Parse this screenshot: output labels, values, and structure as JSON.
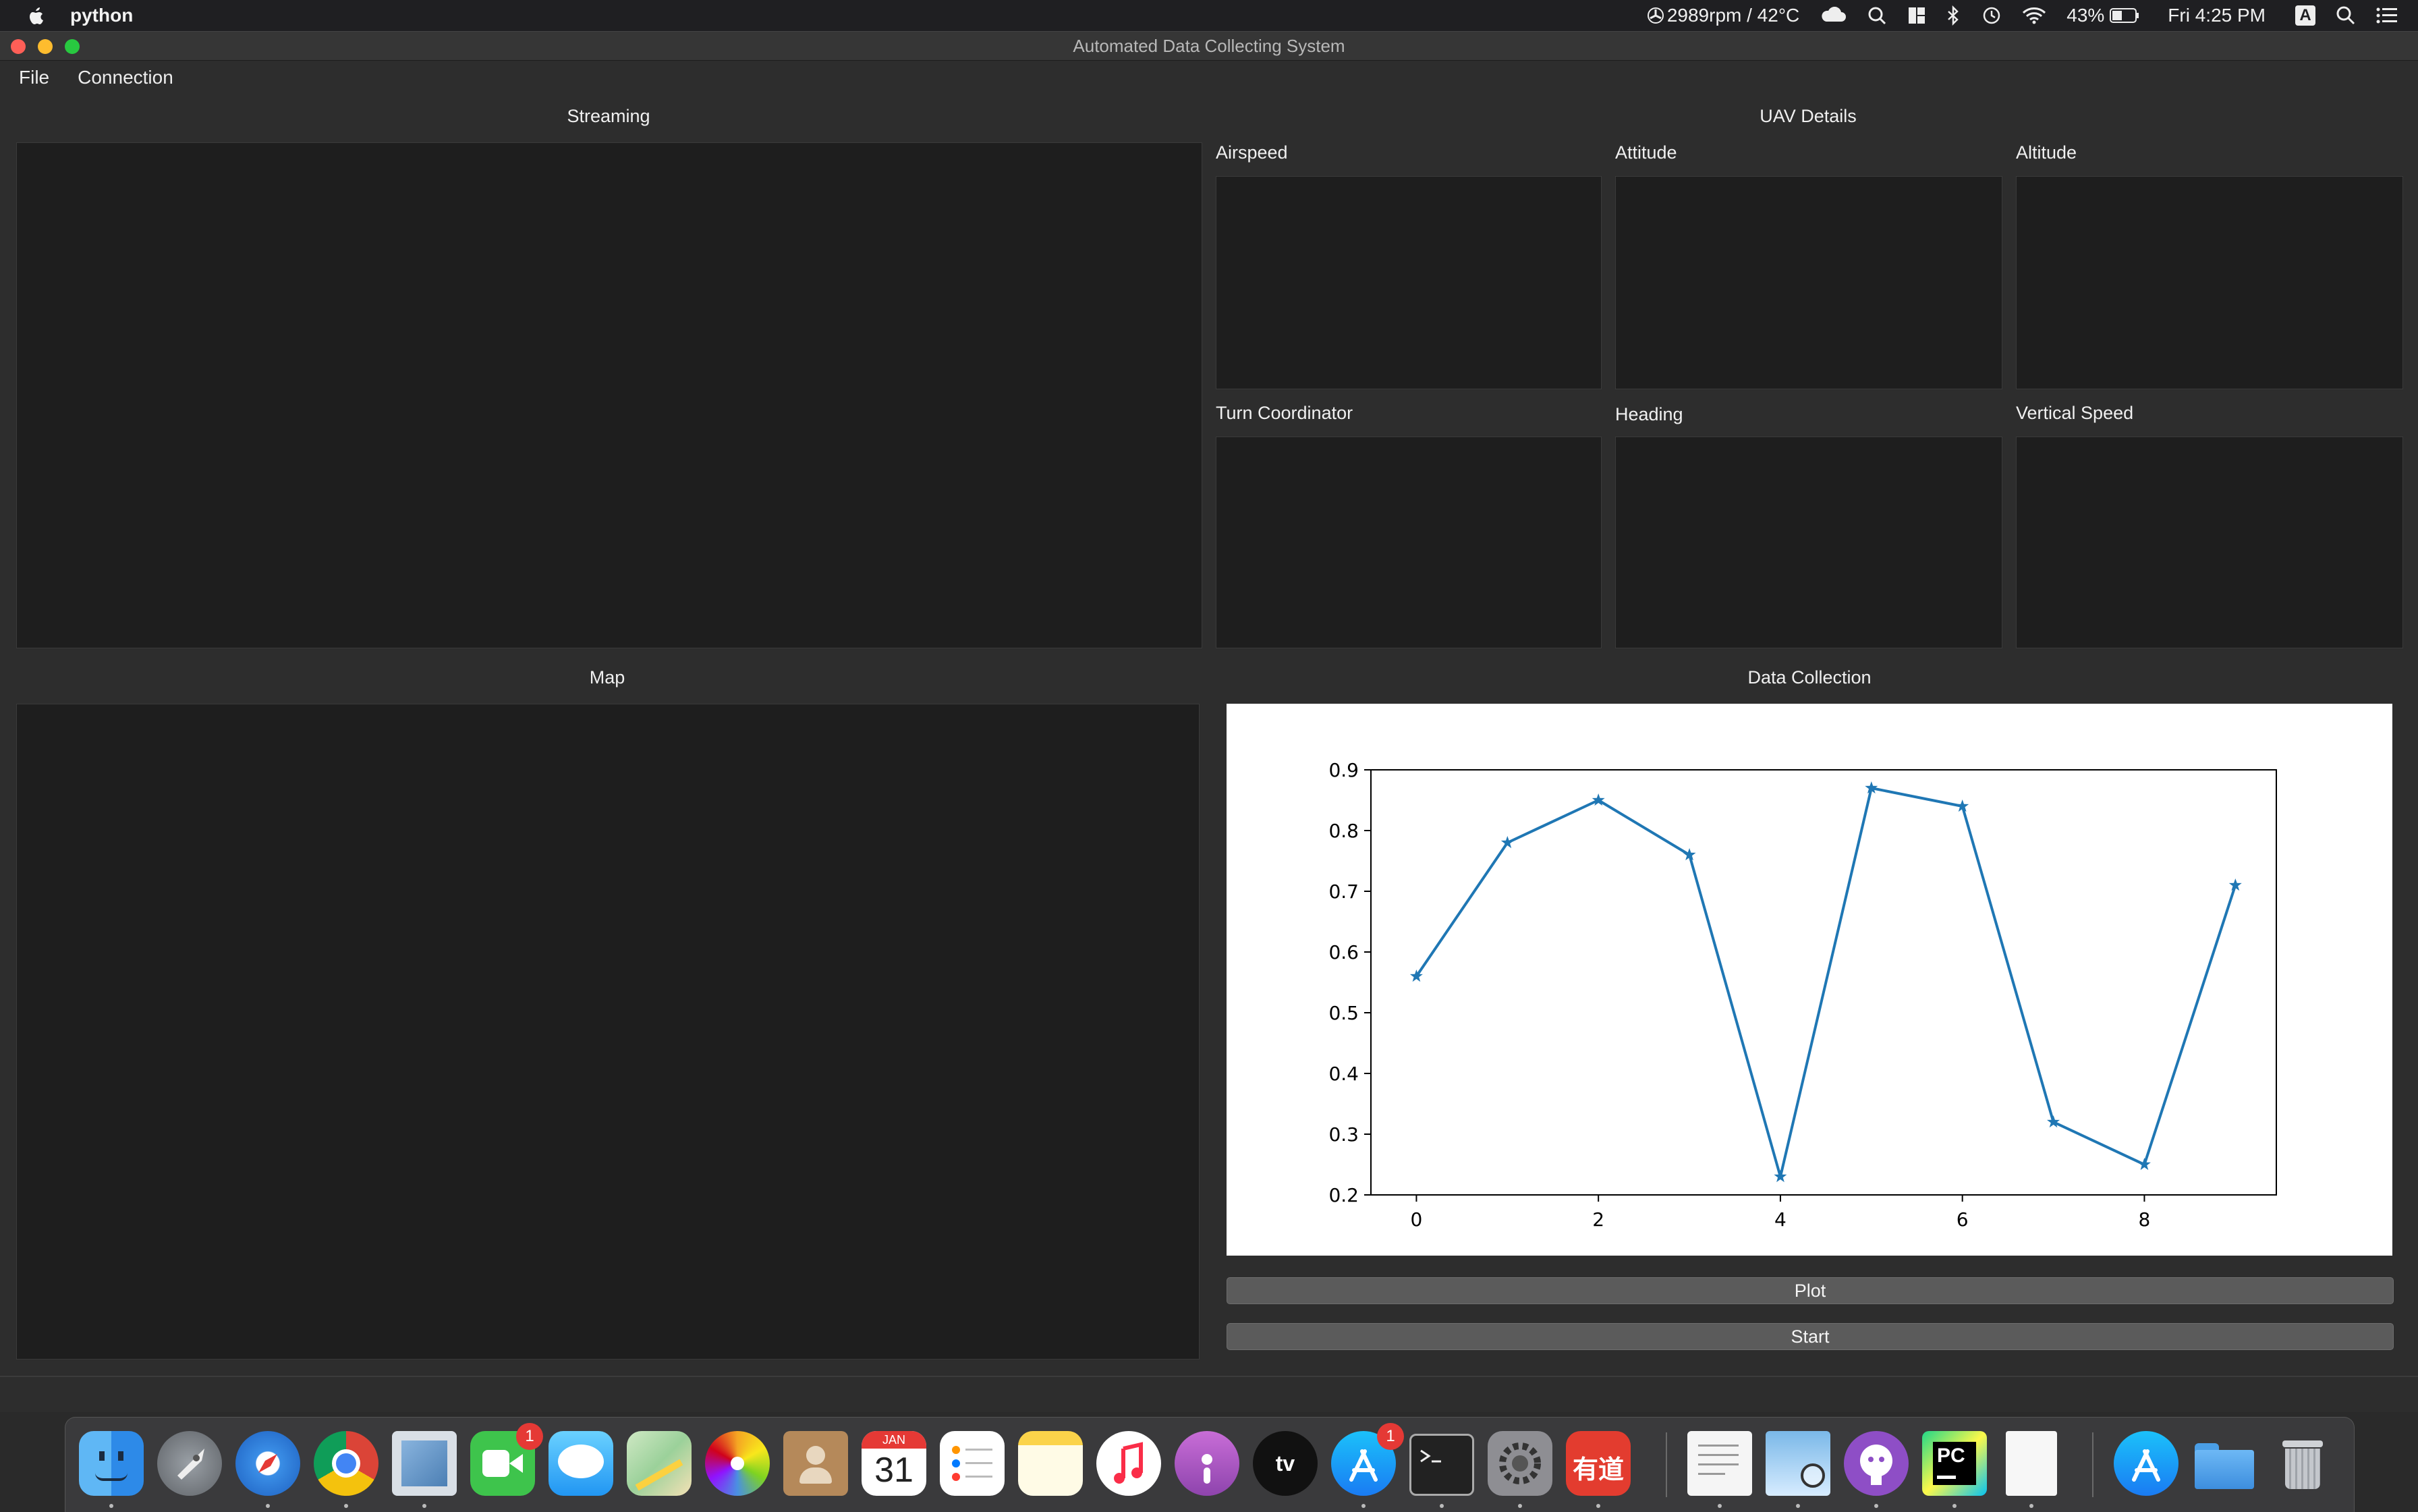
{
  "menubar": {
    "app_name": "python",
    "status": {
      "fan_temp": "2989rpm / 42°C",
      "battery": "43%",
      "clock": "Fri 4:25 PM",
      "input_source": "A"
    }
  },
  "window": {
    "title": "Automated Data Collecting System",
    "menu": [
      "File",
      "Connection"
    ]
  },
  "sections": {
    "streaming": "Streaming",
    "uav_details": "UAV Details",
    "map": "Map",
    "data_collection": "Data Collection"
  },
  "instruments": [
    "Airspeed",
    "Attitude",
    "Altitude",
    "Turn Coordinator",
    "Heading",
    "Vertical Speed"
  ],
  "buttons": {
    "plot": "Plot",
    "start": "Start"
  },
  "colors": {
    "series": "#1f77b4",
    "panel_bg": "#1e1e1e",
    "window_bg": "#2d2d2d"
  },
  "chart_data": {
    "type": "line",
    "marker": "star",
    "x": [
      0,
      1,
      2,
      3,
      4,
      5,
      6,
      7,
      8,
      9
    ],
    "series": [
      {
        "values": [
          0.56,
          0.78,
          0.85,
          0.76,
          0.23,
          0.87,
          0.84,
          0.32,
          0.25,
          0.71
        ]
      }
    ],
    "xticks": [
      0,
      2,
      4,
      6,
      8
    ],
    "yticks": [
      0.2,
      0.3,
      0.4,
      0.5,
      0.6,
      0.7,
      0.8,
      0.9
    ],
    "xlim": [
      -0.5,
      9.45
    ],
    "ylim": [
      0.2,
      0.9
    ],
    "grid": false,
    "legend": false
  },
  "dock": {
    "apps": [
      "finder-icon",
      "launchpad-icon",
      "safari-icon",
      "chrome-icon",
      "mail-icon",
      "facetime-icon",
      "messages-icon",
      "maps-icon",
      "photos-icon",
      "contacts-icon",
      "calendar-icon",
      "reminders-icon",
      "notes-icon",
      "music-icon",
      "podcasts-icon",
      "tv-icon",
      "app-store-icon",
      "terminal-icon",
      "system-preferences-icon",
      "youdao-icon",
      "textedit-icon",
      "preview-icon",
      "github-icon",
      "pycharm-icon",
      "document-icon",
      "app-store-folder-icon",
      "folder-icon",
      "trash-icon"
    ],
    "calendar_month": "JAN",
    "calendar_day": "31",
    "facetime_badge": "1",
    "appstore_badge": "1",
    "tv_label": "tv",
    "youdao_label": "有道",
    "pycharm_label": "PC"
  }
}
